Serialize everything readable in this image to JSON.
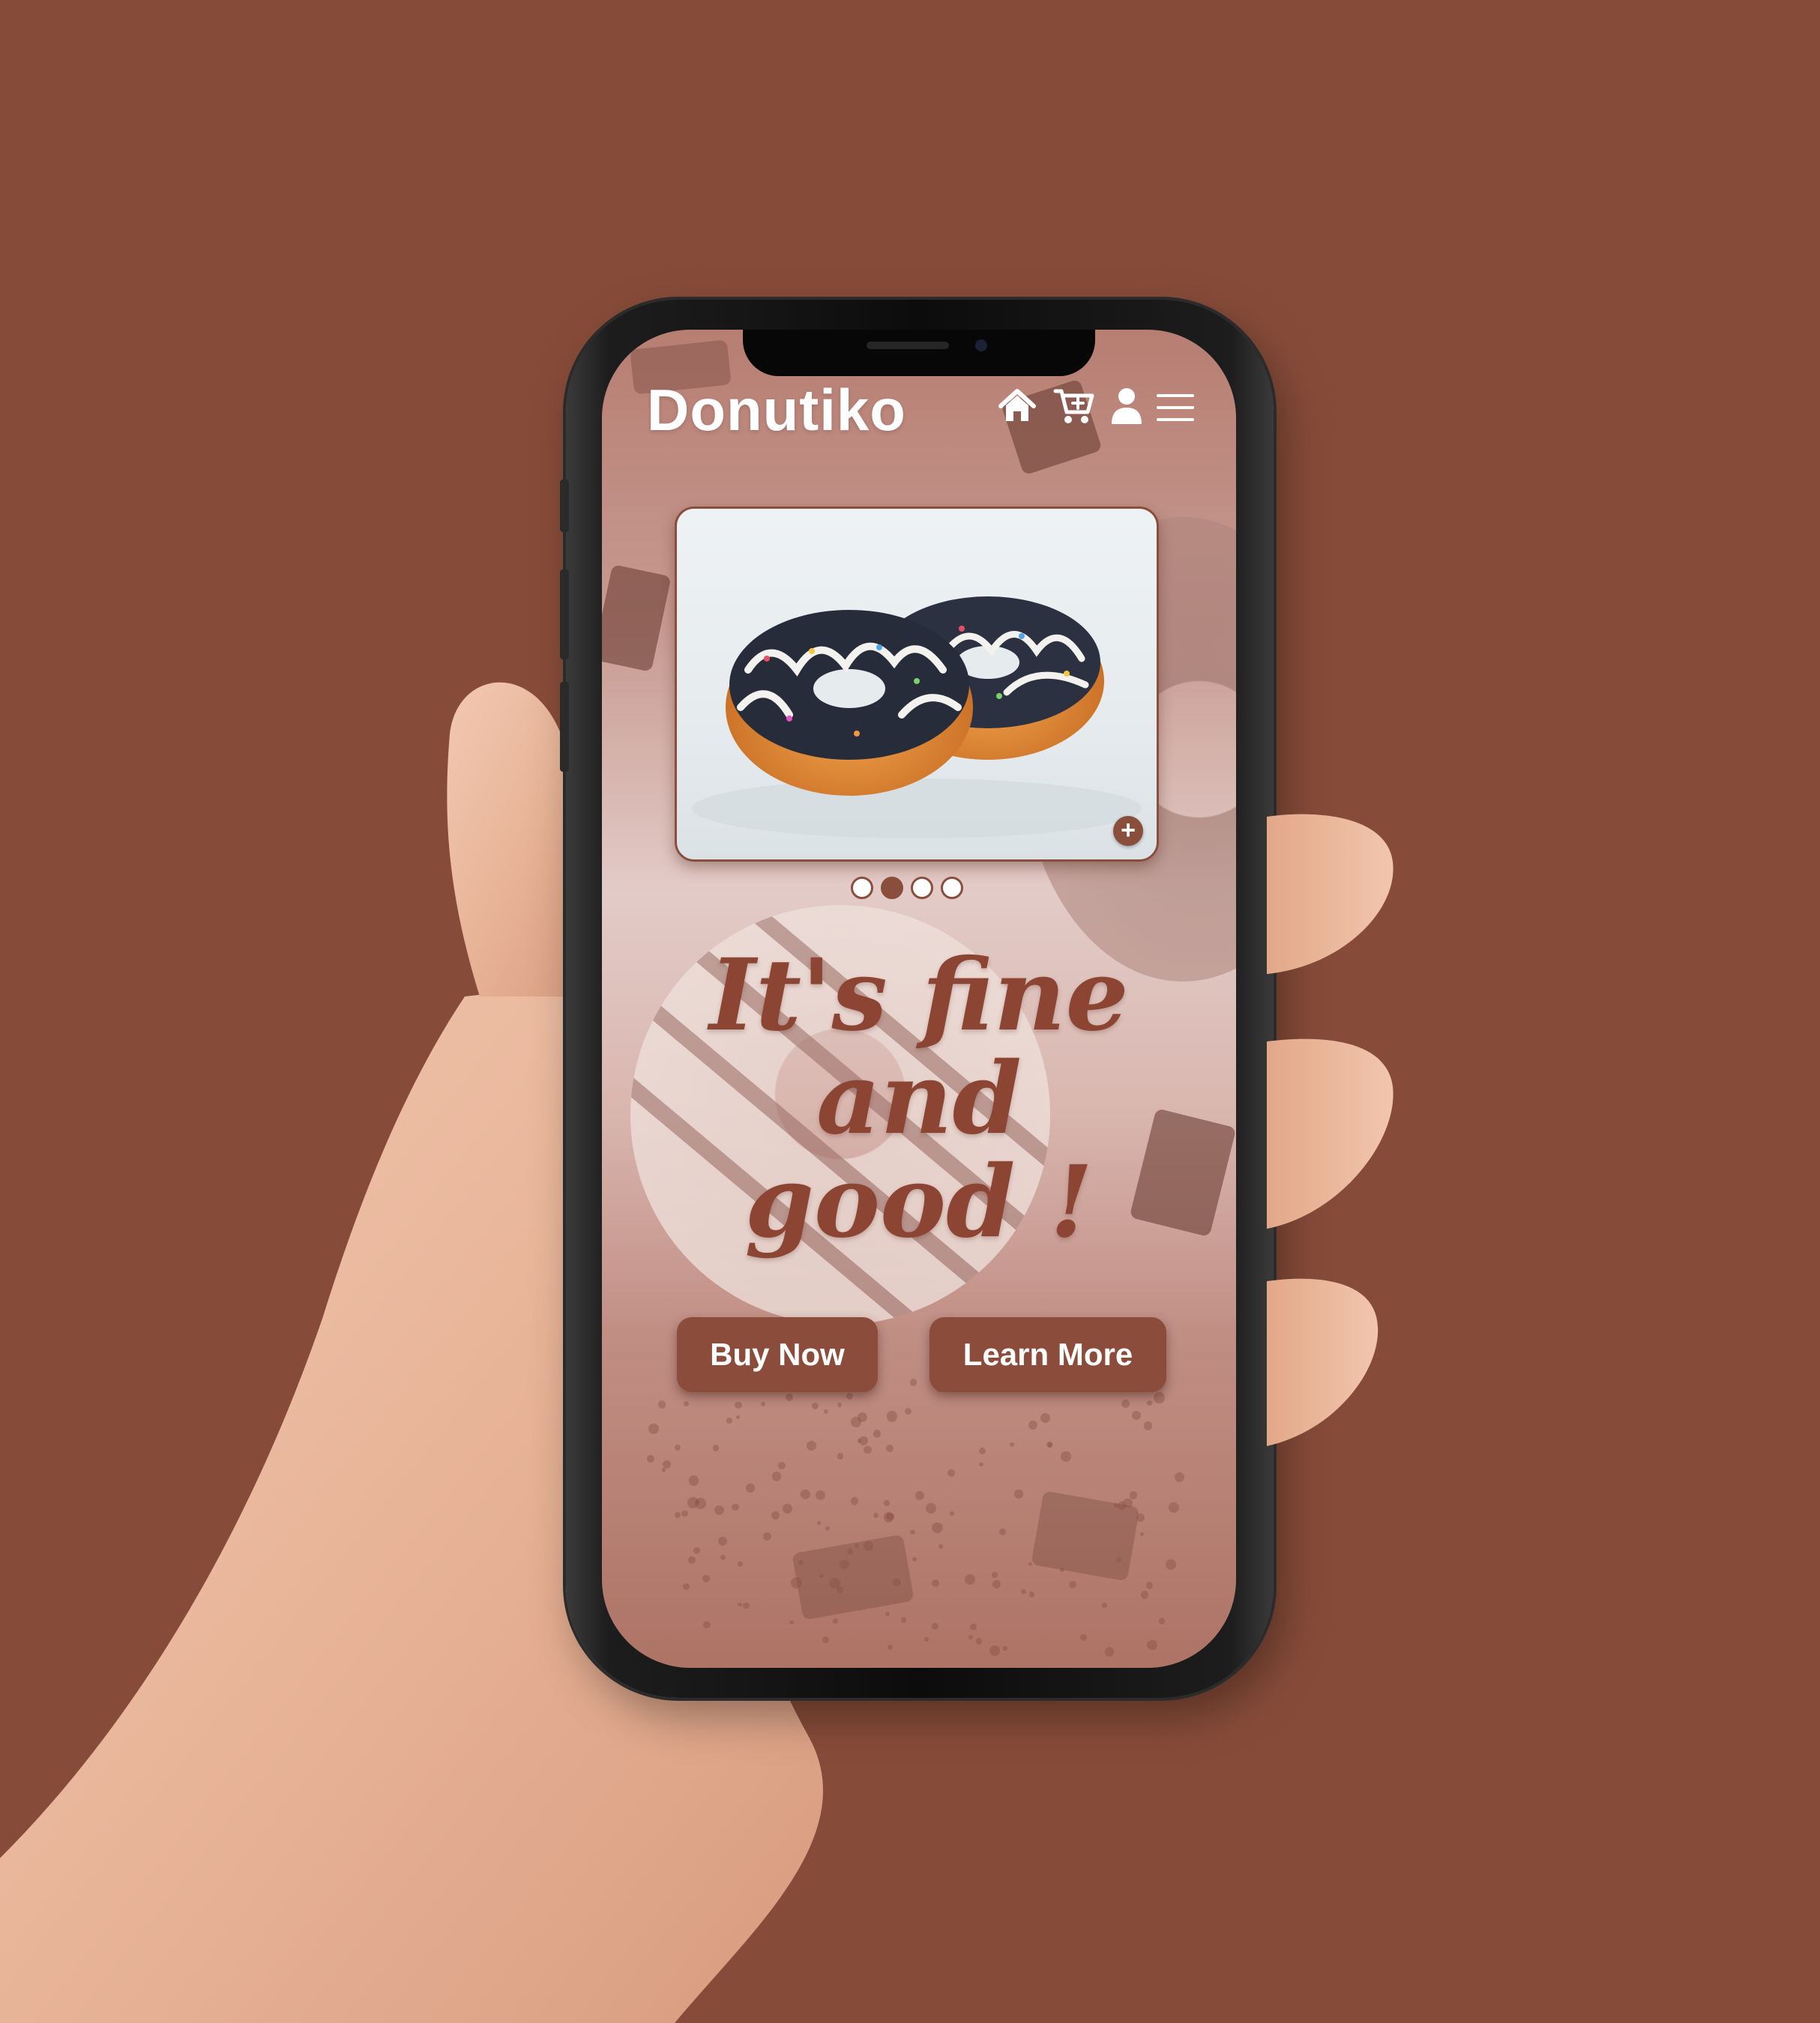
{
  "app": {
    "title": "Donutiko"
  },
  "nav": {
    "icons": [
      "home-icon",
      "add-to-cart-icon",
      "user-icon",
      "menu-icon"
    ]
  },
  "carousel": {
    "slide_count": 4,
    "active_index": 1,
    "add_label": "+"
  },
  "hero": {
    "line1": "It's fine",
    "line2": "and",
    "line3": "good !"
  },
  "buttons": {
    "buy_now": "Buy Now",
    "learn_more": "Learn More"
  },
  "colors": {
    "background": "#874c39",
    "accent": "#8c4c3b",
    "headline": "#8c4433",
    "title": "#ffffff"
  }
}
